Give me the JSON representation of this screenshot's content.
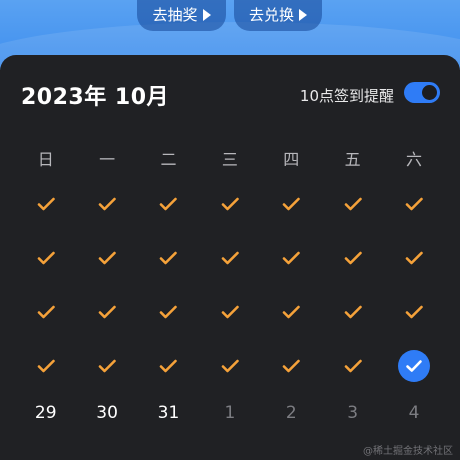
{
  "header": {
    "lottery_label": "去抽奖",
    "exchange_label": "去兑换"
  },
  "calendar": {
    "month_title": "2023年 10月",
    "reminder_label": "10点签到提醒",
    "reminder_on": true,
    "weekdays": [
      "日",
      "一",
      "二",
      "三",
      "四",
      "五",
      "六"
    ],
    "checked_rows": 4,
    "today_position": "row 4, 六",
    "dates": [
      {
        "label": "29",
        "current": true
      },
      {
        "label": "30",
        "current": true
      },
      {
        "label": "31",
        "current": true
      },
      {
        "label": "1",
        "current": false
      },
      {
        "label": "2",
        "current": false
      },
      {
        "label": "3",
        "current": false
      },
      {
        "label": "4",
        "current": false
      }
    ]
  },
  "colors": {
    "accent_blue": "#2f7cf6",
    "check_orange": "#f5a23a",
    "card_bg": "#202124"
  },
  "watermark": "@稀土掘金技术社区"
}
